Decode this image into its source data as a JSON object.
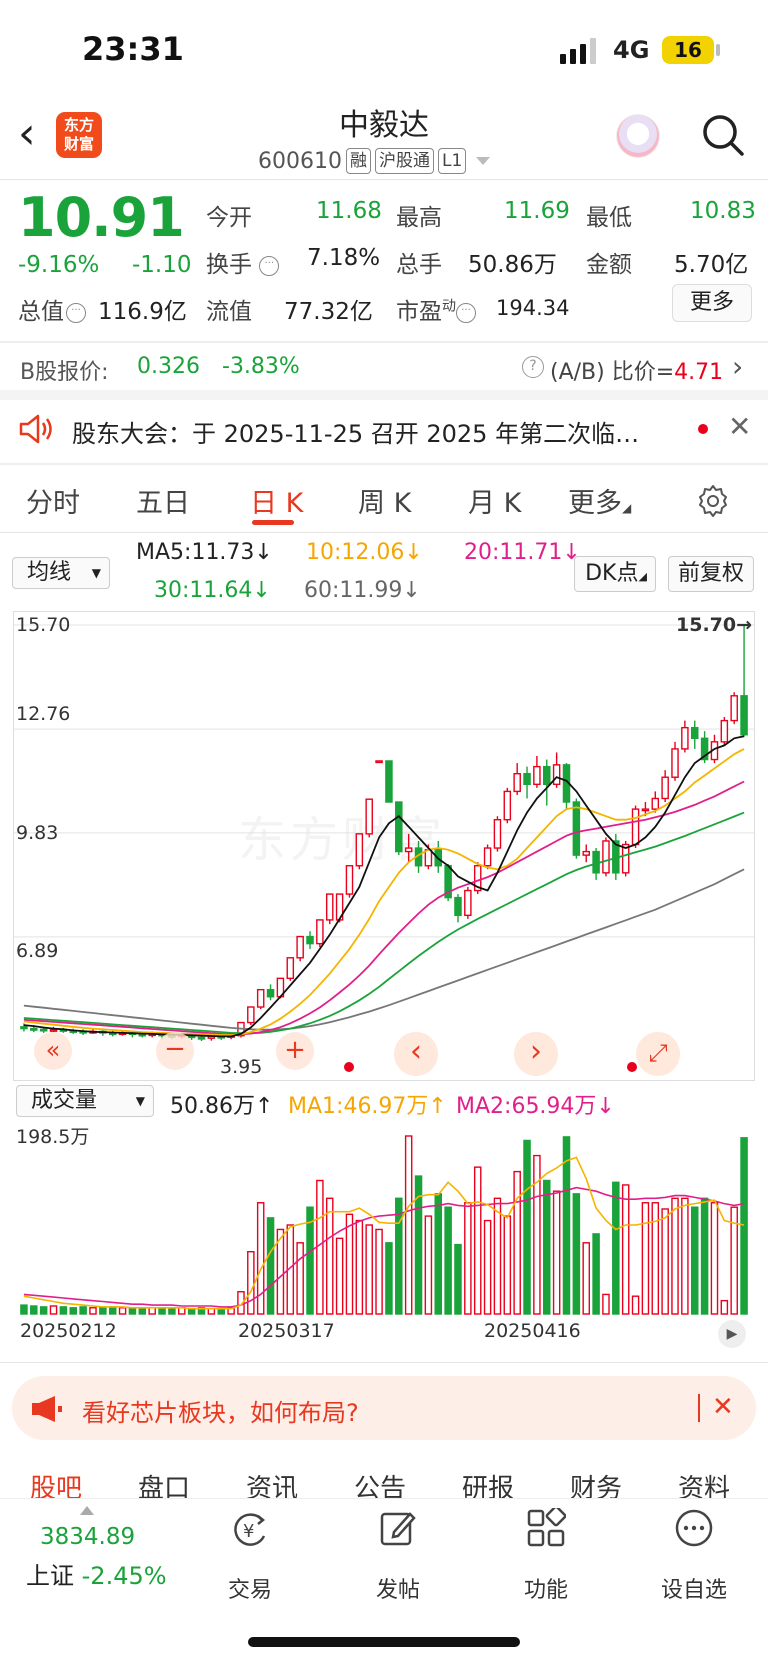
{
  "status": {
    "time": "23:31",
    "network": "4G",
    "battery": "16"
  },
  "header": {
    "logo_line1": "东方",
    "logo_line2": "财富",
    "name": "中毅达",
    "code": "600610",
    "tag1": "融",
    "tag2": "沪股通",
    "tag3": "L1"
  },
  "quote": {
    "price": "10.91",
    "change_pct": "-9.16%",
    "change": "-1.10",
    "open_label": "今开",
    "open": "11.68",
    "high_label": "最高",
    "high": "11.69",
    "low_label": "最低",
    "low": "10.83",
    "turnover_label": "换手",
    "turnover": "7.18%",
    "volume_label": "总手",
    "volume": "50.86万",
    "amount_label": "金额",
    "amount": "5.70亿",
    "mktcap_label": "总值",
    "mktcap": "116.9亿",
    "float_label": "流值",
    "float": "77.32亿",
    "pe_label": "市盈",
    "pe_sup": "动",
    "pe": "194.34",
    "more": "更多"
  },
  "bshare": {
    "label": "B股报价:",
    "price": "0.326",
    "change": "-3.83%",
    "ratio_label": "(A/B) 比价=",
    "ratio": "4.71"
  },
  "notice": {
    "text": "股东大会：于 2025-11-25 召开 2025 年第二次临…"
  },
  "tabs": [
    "分时",
    "五日",
    "日 K",
    "周 K",
    "月 K",
    "更多"
  ],
  "active_tab": "日 K",
  "ma_bar": {
    "selector": "均线",
    "ma5": "MA5:11.73↓",
    "ma10": "10:12.06↓",
    "ma20": "20:11.71↓",
    "ma30": "30:11.64↓",
    "ma60": "60:11.99↓",
    "dk_button": "DK点",
    "fq_button": "前复权"
  },
  "chart_axis": {
    "y1": "15.70",
    "y2": "12.76",
    "y3": "9.83",
    "y4": "6.89",
    "y5": "3.95",
    "max_label": "15.70→",
    "min_label": "3.95"
  },
  "volume_bar": {
    "selector": "成交量",
    "vol": "50.86万↑",
    "ma1": "MA1:46.97万↑",
    "ma2": "MA2:65.94万↓",
    "max": "198.5万"
  },
  "dates": [
    "20250212",
    "20250317",
    "20250416"
  ],
  "chart_data": {
    "type": "candlestick",
    "ylim": [
      3.95,
      15.7
    ],
    "candles": [
      [
        4.35,
        4.3,
        4.45,
        4.22
      ],
      [
        4.3,
        4.28,
        4.4,
        4.2
      ],
      [
        4.28,
        4.25,
        4.35,
        4.18
      ],
      [
        4.25,
        4.27,
        4.35,
        4.2
      ],
      [
        4.27,
        4.24,
        4.32,
        4.18
      ],
      [
        4.24,
        4.22,
        4.3,
        4.15
      ],
      [
        4.22,
        4.2,
        4.28,
        4.12
      ],
      [
        4.2,
        4.22,
        4.3,
        4.15
      ],
      [
        4.22,
        4.18,
        4.26,
        4.1
      ],
      [
        4.18,
        4.15,
        4.24,
        4.08
      ],
      [
        4.15,
        4.18,
        4.25,
        4.1
      ],
      [
        4.18,
        4.14,
        4.22,
        4.05
      ],
      [
        4.14,
        4.12,
        4.2,
        4.05
      ],
      [
        4.12,
        4.15,
        4.22,
        4.05
      ],
      [
        4.15,
        4.1,
        4.2,
        4.0
      ],
      [
        4.1,
        4.08,
        4.16,
        4.0
      ],
      [
        4.08,
        4.12,
        4.18,
        4.02
      ],
      [
        4.12,
        4.05,
        4.15,
        3.98
      ],
      [
        4.05,
        4.03,
        4.1,
        3.95
      ],
      [
        4.03,
        4.08,
        4.14,
        3.96
      ],
      [
        4.08,
        4.06,
        4.12,
        3.98
      ],
      [
        4.06,
        4.1,
        4.15,
        4.0
      ],
      [
        4.1,
        4.47,
        4.47,
        4.05
      ],
      [
        4.47,
        4.91,
        4.91,
        4.4
      ],
      [
        4.91,
        5.4,
        5.4,
        4.85
      ],
      [
        5.4,
        5.2,
        5.55,
        5.1
      ],
      [
        5.2,
        5.72,
        5.72,
        5.15
      ],
      [
        5.72,
        6.3,
        6.3,
        5.65
      ],
      [
        6.3,
        6.9,
        6.9,
        6.2
      ],
      [
        6.9,
        6.7,
        7.05,
        6.55
      ],
      [
        6.7,
        7.37,
        7.37,
        6.6
      ],
      [
        7.37,
        8.1,
        8.1,
        7.25
      ],
      [
        7.37,
        8.1,
        8.1,
        7.3
      ],
      [
        8.1,
        8.9,
        8.9,
        8.0
      ],
      [
        8.9,
        9.8,
        9.8,
        8.8
      ],
      [
        9.8,
        10.78,
        10.78,
        9.7
      ],
      [
        11.86,
        11.86,
        11.86,
        11.86
      ],
      [
        11.86,
        10.7,
        11.86,
        10.7
      ],
      [
        10.7,
        9.3,
        10.7,
        9.2
      ],
      [
        9.3,
        9.4,
        9.8,
        9.0
      ],
      [
        9.4,
        8.9,
        9.6,
        8.7
      ],
      [
        8.9,
        9.35,
        9.5,
        8.8
      ],
      [
        9.35,
        8.9,
        9.6,
        8.7
      ],
      [
        8.9,
        8.0,
        8.95,
        7.9
      ],
      [
        8.0,
        7.5,
        8.1,
        7.3
      ],
      [
        7.5,
        8.2,
        8.3,
        7.4
      ],
      [
        8.2,
        8.9,
        9.0,
        8.1
      ],
      [
        8.9,
        9.4,
        9.5,
        8.8
      ],
      [
        9.4,
        10.2,
        10.3,
        9.3
      ],
      [
        10.2,
        11.0,
        11.1,
        10.1
      ],
      [
        11.0,
        11.5,
        11.8,
        10.9
      ],
      [
        11.5,
        11.2,
        11.7,
        10.8
      ],
      [
        11.2,
        11.7,
        12.0,
        11.1
      ],
      [
        11.7,
        11.2,
        11.9,
        10.6
      ],
      [
        11.2,
        11.75,
        12.1,
        11.1
      ],
      [
        11.75,
        10.7,
        11.8,
        10.5
      ],
      [
        10.7,
        9.2,
        10.8,
        9.1
      ],
      [
        9.2,
        9.3,
        9.5,
        9.0
      ],
      [
        9.3,
        8.7,
        9.4,
        8.5
      ],
      [
        8.7,
        9.6,
        9.7,
        8.6
      ],
      [
        9.6,
        8.7,
        9.8,
        8.5
      ],
      [
        8.7,
        9.5,
        9.6,
        8.6
      ],
      [
        9.5,
        10.5,
        10.6,
        9.4
      ],
      [
        10.5,
        10.5,
        10.7,
        10.3
      ],
      [
        10.5,
        10.8,
        11.0,
        10.4
      ],
      [
        10.8,
        11.4,
        11.6,
        10.7
      ],
      [
        11.4,
        12.2,
        12.4,
        11.3
      ],
      [
        12.2,
        12.8,
        13.0,
        12.1
      ],
      [
        12.8,
        12.5,
        13.0,
        12.2
      ],
      [
        12.5,
        11.9,
        12.7,
        11.8
      ],
      [
        11.9,
        12.4,
        12.6,
        11.8
      ],
      [
        12.4,
        13.0,
        13.1,
        12.3
      ],
      [
        13.0,
        13.7,
        13.8,
        12.9
      ],
      [
        13.7,
        12.6,
        15.7,
        12.55
      ]
    ],
    "ma5": [
      4.4,
      4.37,
      4.33,
      4.3,
      4.28,
      4.25,
      4.23,
      4.21,
      4.2,
      4.19,
      4.18,
      4.17,
      4.16,
      4.15,
      4.14,
      4.13,
      4.12,
      4.11,
      4.1,
      4.09,
      4.08,
      4.08,
      4.15,
      4.33,
      4.6,
      4.9,
      5.2,
      5.52,
      5.84,
      6.16,
      6.55,
      6.95,
      7.4,
      7.85,
      8.3,
      9.0,
      9.7,
      10.1,
      10.3,
      10.0,
      9.7,
      9.4,
      9.1,
      8.9,
      8.6,
      8.45,
      8.3,
      8.2,
      8.7,
      9.3,
      9.9,
      10.4,
      10.8,
      11.1,
      11.4,
      11.3,
      11.0,
      10.6,
      10.2,
      9.8,
      9.5,
      9.4,
      9.5,
      9.7,
      10.0,
      10.4,
      10.9,
      11.4,
      11.8,
      12.0,
      12.2,
      12.3,
      12.5,
      12.56
    ],
    "ma10": [
      4.5,
      4.47,
      4.44,
      4.41,
      4.38,
      4.35,
      4.32,
      4.3,
      4.28,
      4.26,
      4.24,
      4.22,
      4.2,
      4.19,
      4.18,
      4.17,
      4.16,
      4.15,
      4.14,
      4.13,
      4.12,
      4.12,
      4.14,
      4.2,
      4.3,
      4.42,
      4.58,
      4.78,
      5.0,
      5.25,
      5.55,
      5.85,
      6.2,
      6.55,
      6.95,
      7.4,
      7.9,
      8.3,
      8.7,
      9.0,
      9.2,
      9.35,
      9.4,
      9.35,
      9.25,
      9.1,
      8.95,
      8.85,
      8.8,
      8.9,
      9.1,
      9.4,
      9.7,
      10.0,
      10.3,
      10.5,
      10.55,
      10.5,
      10.4,
      10.3,
      10.2,
      10.2,
      10.25,
      10.35,
      10.45,
      10.6,
      10.8,
      11.0,
      11.25,
      11.45,
      11.65,
      11.85,
      12.05,
      12.2
    ],
    "ma20": [
      4.55,
      4.53,
      4.51,
      4.49,
      4.47,
      4.45,
      4.43,
      4.41,
      4.39,
      4.37,
      4.35,
      4.33,
      4.31,
      4.29,
      4.27,
      4.25,
      4.23,
      4.21,
      4.19,
      4.17,
      4.15,
      4.14,
      4.14,
      4.16,
      4.2,
      4.26,
      4.34,
      4.45,
      4.58,
      4.73,
      4.9,
      5.1,
      5.32,
      5.55,
      5.8,
      6.08,
      6.4,
      6.7,
      7.0,
      7.28,
      7.55,
      7.8,
      8.0,
      8.15,
      8.28,
      8.38,
      8.48,
      8.58,
      8.7,
      8.85,
      9.0,
      9.15,
      9.3,
      9.45,
      9.6,
      9.75,
      9.85,
      9.9,
      9.95,
      10.0,
      10.05,
      10.1,
      10.15,
      10.2,
      10.27,
      10.34,
      10.42,
      10.52,
      10.62,
      10.74,
      10.86,
      11.0,
      11.14,
      11.28
    ],
    "ma30": [
      4.6,
      4.58,
      4.56,
      4.54,
      4.52,
      4.5,
      4.48,
      4.46,
      4.44,
      4.42,
      4.4,
      4.38,
      4.36,
      4.34,
      4.32,
      4.3,
      4.28,
      4.26,
      4.24,
      4.22,
      4.2,
      4.18,
      4.17,
      4.17,
      4.18,
      4.21,
      4.25,
      4.3,
      4.37,
      4.45,
      4.55,
      4.66,
      4.79,
      4.94,
      5.1,
      5.28,
      5.48,
      5.7,
      5.92,
      6.14,
      6.35,
      6.55,
      6.75,
      6.93,
      7.1,
      7.25,
      7.4,
      7.54,
      7.68,
      7.82,
      7.96,
      8.1,
      8.24,
      8.38,
      8.52,
      8.66,
      8.78,
      8.88,
      8.96,
      9.04,
      9.12,
      9.2,
      9.28,
      9.36,
      9.44,
      9.54,
      9.64,
      9.74,
      9.85,
      9.96,
      10.07,
      10.18,
      10.29,
      10.4
    ],
    "ma60": [
      4.95,
      4.92,
      4.89,
      4.86,
      4.83,
      4.8,
      4.77,
      4.74,
      4.71,
      4.68,
      4.65,
      4.62,
      4.59,
      4.56,
      4.53,
      4.5,
      4.47,
      4.44,
      4.41,
      4.38,
      4.35,
      4.32,
      4.3,
      4.28,
      4.27,
      4.27,
      4.28,
      4.3,
      4.33,
      4.37,
      4.42,
      4.48,
      4.55,
      4.62,
      4.7,
      4.78,
      4.87,
      4.96,
      5.06,
      5.16,
      5.26,
      5.36,
      5.46,
      5.56,
      5.66,
      5.76,
      5.86,
      5.96,
      6.06,
      6.16,
      6.26,
      6.36,
      6.46,
      6.56,
      6.66,
      6.76,
      6.86,
      6.96,
      7.06,
      7.16,
      7.26,
      7.36,
      7.46,
      7.56,
      7.66,
      7.78,
      7.9,
      8.02,
      8.14,
      8.26,
      8.38,
      8.52,
      8.66,
      8.8
    ],
    "volume": [
      10,
      9,
      8,
      9,
      8,
      7,
      8,
      7,
      7,
      8,
      7,
      7,
      6,
      7,
      7,
      6,
      7,
      6,
      7,
      6,
      6,
      7,
      25,
      70,
      125,
      108,
      95,
      100,
      80,
      120,
      150,
      130,
      85,
      112,
      105,
      100,
      95,
      80,
      130,
      200,
      155,
      110,
      135,
      120,
      78,
      125,
      165,
      105,
      130,
      110,
      160,
      195,
      178,
      150,
      138,
      199,
      135,
      80,
      90,
      22,
      148,
      145,
      20,
      125,
      125,
      118,
      130,
      130,
      120,
      130,
      125,
      15,
      120,
      198
    ],
    "vol_ma1": [
      20,
      18,
      16,
      14,
      12,
      11,
      10,
      9,
      8,
      8,
      8,
      7,
      7,
      7,
      7,
      7,
      7,
      6,
      6,
      6,
      6,
      6,
      10,
      25,
      50,
      70,
      85,
      98,
      101,
      103,
      108,
      115,
      115,
      115,
      119,
      112,
      103,
      102,
      102,
      121,
      132,
      134,
      134,
      148,
      138,
      124,
      126,
      123,
      115,
      108,
      130,
      140,
      148,
      158,
      164,
      172,
      176,
      152,
      119,
      105,
      95,
      100,
      100,
      102,
      104,
      108,
      118,
      122,
      124,
      126,
      128,
      105,
      102,
      100
    ],
    "vol_ma2": [
      22,
      21,
      20,
      19,
      18,
      17,
      16,
      15,
      14,
      13,
      12,
      11,
      11,
      10,
      10,
      10,
      9,
      9,
      9,
      9,
      8,
      8,
      10,
      15,
      22,
      32,
      42,
      52,
      62,
      70,
      78,
      86,
      93,
      99,
      104,
      108,
      110,
      111,
      112,
      116,
      119,
      121,
      122,
      124,
      122,
      121,
      122,
      123,
      124,
      124,
      126,
      128,
      132,
      134,
      136,
      139,
      142,
      140,
      138,
      134,
      131,
      129,
      129,
      130,
      130,
      131,
      133,
      133,
      131,
      129,
      127,
      124,
      122,
      124
    ]
  },
  "banner": {
    "text": "看好芯片板块，如何布局?"
  },
  "bottom_tabs": [
    "股吧",
    "盘口",
    "资讯",
    "公告",
    "研报",
    "财务",
    "资料"
  ],
  "dock": {
    "index_value": "3834.89",
    "index_name": "上证",
    "index_change": "-2.45%",
    "trade": "交易",
    "post": "发帖",
    "func": "功能",
    "watch": "设自选"
  }
}
